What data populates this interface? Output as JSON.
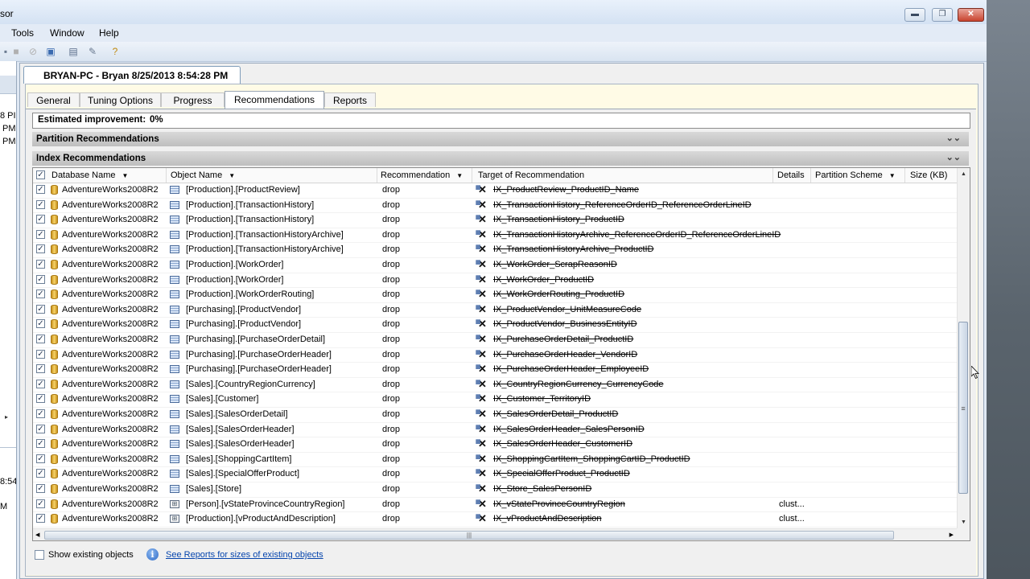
{
  "window": {
    "title": "sor",
    "controls": {
      "minimize": "▬",
      "maximize": "❐",
      "close": "✕"
    }
  },
  "menu": {
    "tools": "Tools",
    "window": "Window",
    "help": "Help",
    "close_glyph": "✕"
  },
  "left_panel": {
    "lines": [
      "8 PI",
      "PM",
      "PM",
      "8:54",
      "M"
    ],
    "arrow": "▸"
  },
  "session_tab": {
    "title": "BRYAN-PC - Bryan 8/25/2013 8:54:28 PM"
  },
  "tabs": [
    {
      "label": "General",
      "active": false
    },
    {
      "label": "Tuning Options",
      "active": false
    },
    {
      "label": "Progress",
      "active": false
    },
    {
      "label": "Recommendations",
      "active": true
    },
    {
      "label": "Reports",
      "active": false
    }
  ],
  "estimated_improvement": {
    "label": "Estimated improvement:",
    "value": "0%"
  },
  "sections": {
    "partition": {
      "title": "Partition Recommendations",
      "chevron": "⌄⌄"
    },
    "index": {
      "title": "Index Recommendations",
      "chevron": "⌄⌄"
    }
  },
  "grid": {
    "columns": {
      "database": "Database Name",
      "object": "Object Name",
      "recommendation": "Recommendation",
      "target": "Target of Recommendation",
      "details": "Details",
      "partition_scheme": "Partition Scheme",
      "size": "Size (KB)"
    },
    "sort_glyph": "▼",
    "rows": [
      {
        "db": "AdventureWorks2008R2",
        "obj": "[Production].[ProductReview]",
        "rec": "drop",
        "target": "IX_ProductReview_ProductID_Name",
        "details": "",
        "view": false
      },
      {
        "db": "AdventureWorks2008R2",
        "obj": "[Production].[TransactionHistory]",
        "rec": "drop",
        "target": "IX_TransactionHistory_ReferenceOrderID_ReferenceOrderLineID",
        "details": "",
        "view": false
      },
      {
        "db": "AdventureWorks2008R2",
        "obj": "[Production].[TransactionHistory]",
        "rec": "drop",
        "target": "IX_TransactionHistory_ProductID",
        "details": "",
        "view": false
      },
      {
        "db": "AdventureWorks2008R2",
        "obj": "[Production].[TransactionHistoryArchive]",
        "rec": "drop",
        "target": "IX_TransactionHistoryArchive_ReferenceOrderID_ReferenceOrderLineID",
        "details": "",
        "view": false
      },
      {
        "db": "AdventureWorks2008R2",
        "obj": "[Production].[TransactionHistoryArchive]",
        "rec": "drop",
        "target": "IX_TransactionHistoryArchive_ProductID",
        "details": "",
        "view": false
      },
      {
        "db": "AdventureWorks2008R2",
        "obj": "[Production].[WorkOrder]",
        "rec": "drop",
        "target": "IX_WorkOrder_ScrapReasonID",
        "details": "",
        "view": false
      },
      {
        "db": "AdventureWorks2008R2",
        "obj": "[Production].[WorkOrder]",
        "rec": "drop",
        "target": "IX_WorkOrder_ProductID",
        "details": "",
        "view": false
      },
      {
        "db": "AdventureWorks2008R2",
        "obj": "[Production].[WorkOrderRouting]",
        "rec": "drop",
        "target": "IX_WorkOrderRouting_ProductID",
        "details": "",
        "view": false
      },
      {
        "db": "AdventureWorks2008R2",
        "obj": "[Purchasing].[ProductVendor]",
        "rec": "drop",
        "target": "IX_ProductVendor_UnitMeasureCode",
        "details": "",
        "view": false
      },
      {
        "db": "AdventureWorks2008R2",
        "obj": "[Purchasing].[ProductVendor]",
        "rec": "drop",
        "target": "IX_ProductVendor_BusinessEntityID",
        "details": "",
        "view": false
      },
      {
        "db": "AdventureWorks2008R2",
        "obj": "[Purchasing].[PurchaseOrderDetail]",
        "rec": "drop",
        "target": "IX_PurchaseOrderDetail_ProductID",
        "details": "",
        "view": false
      },
      {
        "db": "AdventureWorks2008R2",
        "obj": "[Purchasing].[PurchaseOrderHeader]",
        "rec": "drop",
        "target": "IX_PurchaseOrderHeader_VendorID",
        "details": "",
        "view": false
      },
      {
        "db": "AdventureWorks2008R2",
        "obj": "[Purchasing].[PurchaseOrderHeader]",
        "rec": "drop",
        "target": "IX_PurchaseOrderHeader_EmployeeID",
        "details": "",
        "view": false
      },
      {
        "db": "AdventureWorks2008R2",
        "obj": "[Sales].[CountryRegionCurrency]",
        "rec": "drop",
        "target": "IX_CountryRegionCurrency_CurrencyCode",
        "details": "",
        "view": false
      },
      {
        "db": "AdventureWorks2008R2",
        "obj": "[Sales].[Customer]",
        "rec": "drop",
        "target": "IX_Customer_TerritoryID",
        "details": "",
        "view": false
      },
      {
        "db": "AdventureWorks2008R2",
        "obj": "[Sales].[SalesOrderDetail]",
        "rec": "drop",
        "target": "IX_SalesOrderDetail_ProductID",
        "details": "",
        "view": false
      },
      {
        "db": "AdventureWorks2008R2",
        "obj": "[Sales].[SalesOrderHeader]",
        "rec": "drop",
        "target": "IX_SalesOrderHeader_SalesPersonID",
        "details": "",
        "view": false
      },
      {
        "db": "AdventureWorks2008R2",
        "obj": "[Sales].[SalesOrderHeader]",
        "rec": "drop",
        "target": "IX_SalesOrderHeader_CustomerID",
        "details": "",
        "view": false
      },
      {
        "db": "AdventureWorks2008R2",
        "obj": "[Sales].[ShoppingCartItem]",
        "rec": "drop",
        "target": "IX_ShoppingCartItem_ShoppingCartID_ProductID",
        "details": "",
        "view": false
      },
      {
        "db": "AdventureWorks2008R2",
        "obj": "[Sales].[SpecialOfferProduct]",
        "rec": "drop",
        "target": "IX_SpecialOfferProduct_ProductID",
        "details": "",
        "view": false
      },
      {
        "db": "AdventureWorks2008R2",
        "obj": "[Sales].[Store]",
        "rec": "drop",
        "target": "IX_Store_SalesPersonID",
        "details": "",
        "view": false
      },
      {
        "db": "AdventureWorks2008R2",
        "obj": "[Person].[vStateProvinceCountryRegion]",
        "rec": "drop",
        "target": "IX_vStateProvinceCountryRegion",
        "details": "clust...",
        "view": true
      },
      {
        "db": "AdventureWorks2008R2",
        "obj": "[Production].[vProductAndDescription]",
        "rec": "drop",
        "target": "IX_vProductAndDescription",
        "details": "clust...",
        "view": true
      }
    ]
  },
  "footer": {
    "show_existing_label": "Show existing objects",
    "reports_link": "See Reports for sizes of existing objects"
  }
}
